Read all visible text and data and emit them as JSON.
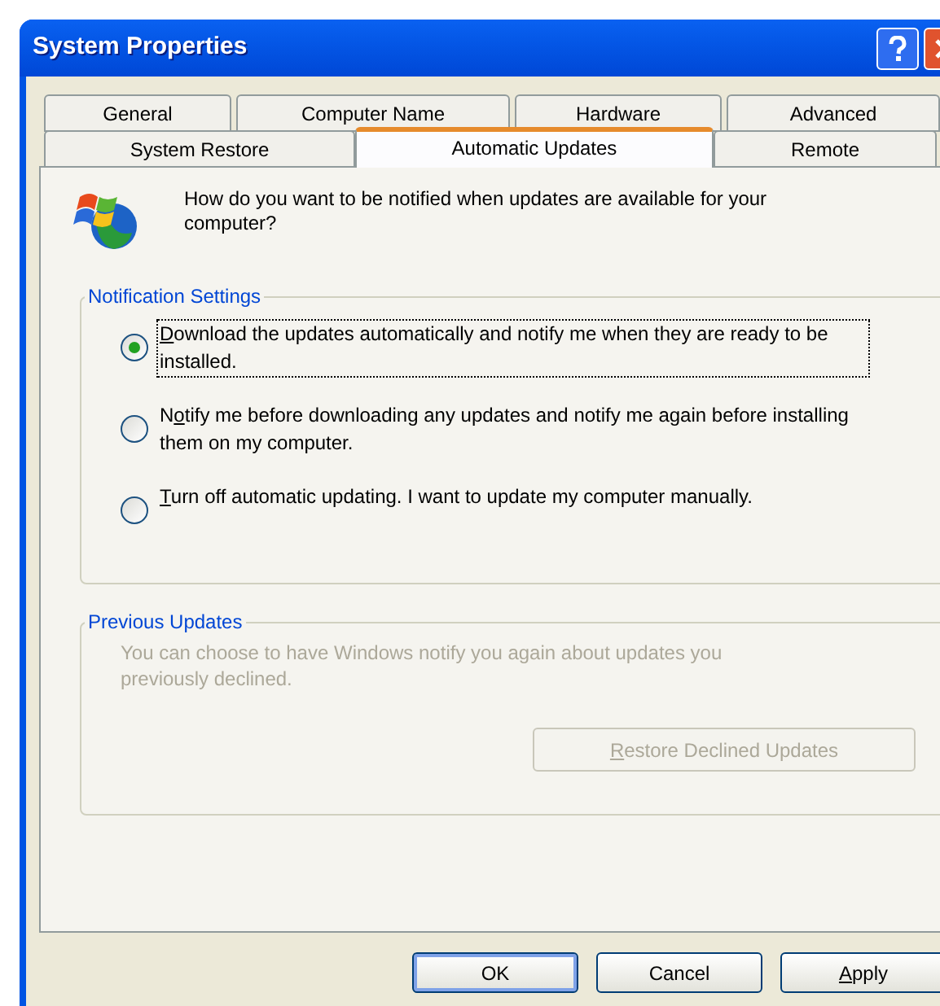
{
  "window": {
    "title": "System Properties"
  },
  "tab_rows": [
    [
      {
        "label": "General",
        "selected": false
      },
      {
        "label": "Computer Name",
        "selected": false
      },
      {
        "label": "Hardware",
        "selected": false
      },
      {
        "label": "Advanced",
        "selected": false
      }
    ],
    [
      {
        "label": "System Restore",
        "selected": false
      },
      {
        "label": "Automatic Updates",
        "selected": true
      },
      {
        "label": "Remote",
        "selected": false
      }
    ]
  ],
  "question": "How do you want to be notified when updates are available for your computer?",
  "notification_settings": {
    "title": "Notification Settings",
    "options": [
      {
        "label": {
          "key": "D",
          "after": "ownload the updates automatically and notify me when they are ready to be installed."
        },
        "selected": true
      },
      {
        "label": {
          "before": "N",
          "key": "o",
          "after": "tify me before downloading any updates and notify me again before installing them on my computer."
        },
        "selected": false
      },
      {
        "label": {
          "key": "T",
          "after": "urn off automatic updating. I want to update my computer manually."
        },
        "selected": false
      }
    ]
  },
  "previous_updates": {
    "title": "Previous Updates",
    "text": "You can choose to have Windows notify you again about updates you previously declined.",
    "button": {
      "label": {
        "key": "R",
        "after": "estore Declined Updates"
      },
      "disabled": true
    }
  },
  "buttons": [
    {
      "label": {
        "after": "OK"
      },
      "default": true
    },
    {
      "label": {
        "after": "Cancel"
      },
      "default": false
    },
    {
      "label": {
        "key": "A",
        "after": "pply"
      },
      "default": false
    }
  ]
}
